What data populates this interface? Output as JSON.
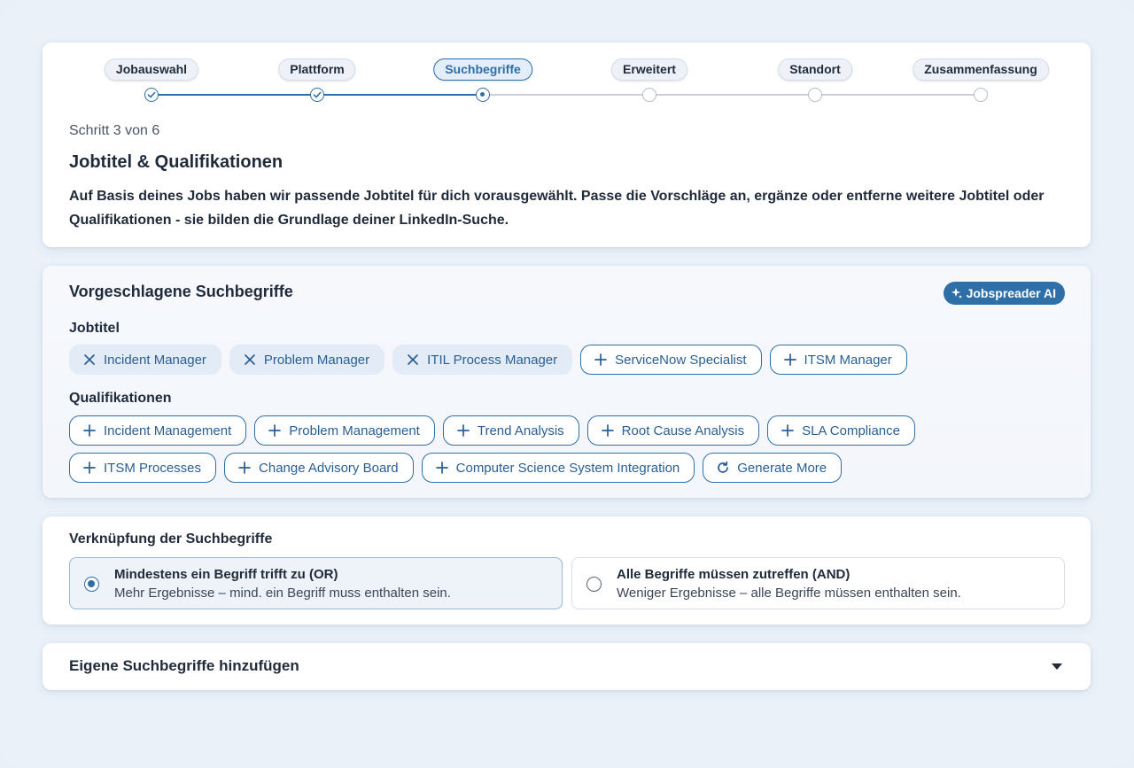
{
  "stepper": {
    "steps": [
      {
        "label": "Jobauswahl",
        "state": "done"
      },
      {
        "label": "Plattform",
        "state": "done"
      },
      {
        "label": "Suchbegriffe",
        "state": "active"
      },
      {
        "label": "Erweitert",
        "state": "todo"
      },
      {
        "label": "Standort",
        "state": "todo"
      },
      {
        "label": "Zusammenfassung",
        "state": "todo"
      }
    ],
    "step_count": "Schritt 3 von 6",
    "title": "Jobtitel & Qualifikationen",
    "description": "Auf Basis deines Jobs haben wir passende Jobtitel für dich vorausgewählt. Passe die Vorschläge an, ergänze oder entferne weitere Jobtitel oder Qualifikationen - sie bilden die Grundlage deiner LinkedIn-Suche."
  },
  "suggestions": {
    "title": "Vorgeschlagene Suchbegriffe",
    "ai_badge": "Jobspreader AI",
    "jobtitles_label": "Jobtitel",
    "jobtitles": [
      {
        "label": "Incident Manager",
        "selected": true
      },
      {
        "label": "Problem Manager",
        "selected": true
      },
      {
        "label": "ITIL Process Manager",
        "selected": true
      },
      {
        "label": "ServiceNow Specialist",
        "selected": false
      },
      {
        "label": "ITSM Manager",
        "selected": false
      }
    ],
    "qualifications_label": "Qualifikationen",
    "qualifications_row1": [
      "Incident Management",
      "Problem Management",
      "Trend Analysis",
      "Root Cause Analysis",
      "SLA Compliance"
    ],
    "qualifications_row2": [
      "ITSM Processes",
      "Change Advisory Board",
      "Computer Science System Integration"
    ],
    "generate_more": "Generate More"
  },
  "operator": {
    "title": "Verknüpfung der Suchbegriffe",
    "options": [
      {
        "title": "Mindestens ein Begriff trifft zu (OR)",
        "subtitle": "Mehr Ergebnisse – mind. ein Begriff muss enthalten sein.",
        "selected": true
      },
      {
        "title": "Alle Begriffe müssen zutreffen (AND)",
        "subtitle": "Weniger Ergebnisse – alle Begriffe müssen enthalten sein.",
        "selected": false
      }
    ]
  },
  "custom": {
    "title": "Eigene Suchbegriffe hinzufügen"
  },
  "colors": {
    "accent": "#2f6fa8",
    "background": "#eaf1f9",
    "chip_selected_bg": "#e3ebf6"
  }
}
